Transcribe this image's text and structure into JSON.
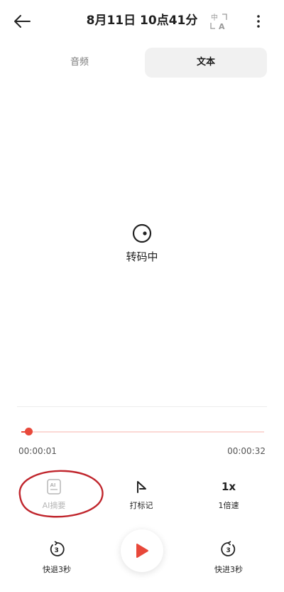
{
  "header": {
    "title": "8月11日 10点41分",
    "back_icon": "arrow-left-icon",
    "translate_icon": "translate-icon",
    "translate_chars": {
      "zh": "中",
      "a": "A"
    },
    "more_icon": "more-vertical-icon"
  },
  "tabs": [
    {
      "label": "音频",
      "active": false
    },
    {
      "label": "文本",
      "active": true
    }
  ],
  "status": {
    "label": "转码中",
    "icon": "loading-icon"
  },
  "player": {
    "current_time": "00:00:01",
    "total_time": "00:00:32",
    "progress": 0.03,
    "accent_color": "#e8483a",
    "track_color": "#fbd9d5"
  },
  "tools": {
    "ai_summary": {
      "label": "AI摘要",
      "icon": "ai-summary-icon",
      "icon_text": "AI",
      "enabled": false
    },
    "mark": {
      "label": "打标记",
      "icon": "flag-icon"
    },
    "speed": {
      "label": "1倍速",
      "icon_text": "1x",
      "icon": "speed-icon"
    }
  },
  "playback": {
    "rewind": {
      "label": "快退3秒",
      "icon_text": "3",
      "icon": "rewind-icon"
    },
    "play": {
      "icon": "play-icon"
    },
    "forward": {
      "label": "快进3秒",
      "icon_text": "3",
      "icon": "forward-icon"
    }
  },
  "annotation": {
    "color": "#c0262d"
  }
}
